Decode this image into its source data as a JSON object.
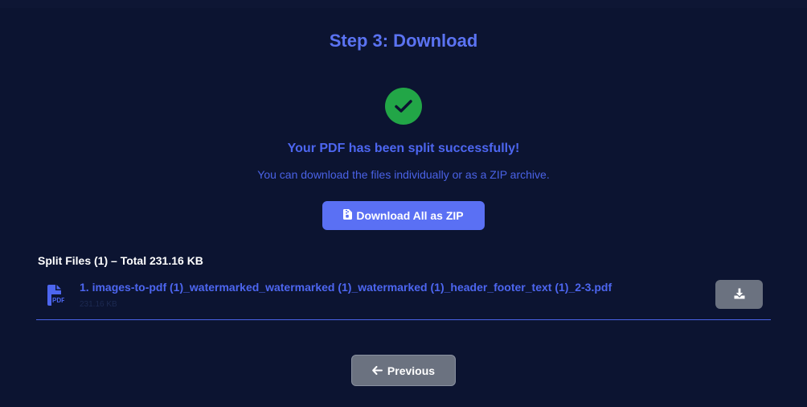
{
  "step": {
    "title": "Step 3: Download"
  },
  "success": {
    "title": "Your PDF has been split successfully!",
    "subtitle": "You can download the files individually or as a ZIP archive."
  },
  "zip_button": {
    "label": "Download All as ZIP",
    "icon": "file-zipper-icon"
  },
  "files": {
    "heading": "Split Files (1) – Total 231.16 KB",
    "items": [
      {
        "name": "1. images-to-pdf (1)_watermarked_watermarked (1)_watermarked (1)_header_footer_text (1)_2-3.pdf",
        "size": "231.16 KB",
        "icon": "pdf-file-icon",
        "action_icon": "download-icon"
      }
    ]
  },
  "navigation": {
    "previous_label": "Previous",
    "previous_icon": "arrow-left-icon"
  },
  "colors": {
    "background": "#0c1431",
    "accent": "#5a70f4",
    "success": "#22a647",
    "secondary_button": "#6b7280"
  }
}
